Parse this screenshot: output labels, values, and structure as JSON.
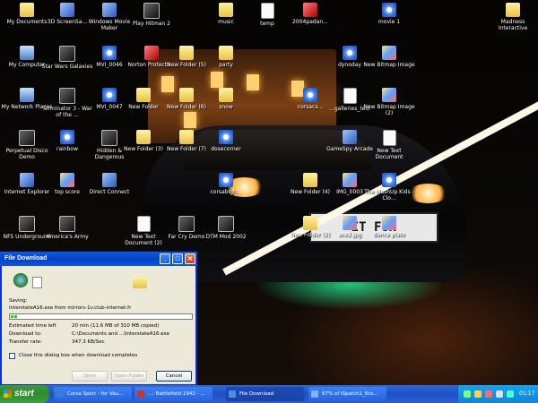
{
  "desktop": {
    "icons": [
      {
        "label": "My Documents",
        "glyph": "folder-docs"
      },
      {
        "label": "3D ScreenSa...",
        "glyph": "screensaver"
      },
      {
        "label": "Windows Movie Maker",
        "glyph": "movie-maker"
      },
      {
        "label": "Play Hitman 2",
        "glyph": "game"
      },
      {
        "label": "music",
        "glyph": "folder"
      },
      {
        "label": "temp",
        "glyph": "document"
      },
      {
        "label": "2004padan...",
        "glyph": "pdf"
      },
      {
        "label": "movie 1",
        "glyph": "media"
      },
      {
        "label": "Madness Interactive",
        "glyph": "folder"
      },
      {
        "label": "My Computer",
        "glyph": "computer"
      },
      {
        "label": "Star Wars Galaxies",
        "glyph": "game"
      },
      {
        "label": "MVI_0046",
        "glyph": "media"
      },
      {
        "label": "Norton Protecte...",
        "glyph": "norton"
      },
      {
        "label": "New Folder (5)",
        "glyph": "folder"
      },
      {
        "label": "party",
        "glyph": "folder"
      },
      {
        "label": "dynoday",
        "glyph": "media"
      },
      {
        "label": "New Bitmap Image",
        "glyph": "paint"
      },
      {
        "label": "My Network Places",
        "glyph": "network"
      },
      {
        "label": "Terminator 3 - War of the ...",
        "glyph": "game"
      },
      {
        "label": "MVI_0047",
        "glyph": "media"
      },
      {
        "label": "New Folder",
        "glyph": "folder"
      },
      {
        "label": "New Folder (6)",
        "glyph": "folder"
      },
      {
        "label": "snow",
        "glyph": "folder"
      },
      {
        "label": "corsacs...",
        "glyph": "media"
      },
      {
        "label": "...galleries_tedi",
        "glyph": "document"
      },
      {
        "label": "New Bitmap Image (2)",
        "glyph": "paint"
      },
      {
        "label": "Perpetual Disco Demo",
        "glyph": "game"
      },
      {
        "label": "rainbow",
        "glyph": "media"
      },
      {
        "label": "Hidden & Dangerous",
        "glyph": "game"
      },
      {
        "label": "New Folder (3)",
        "glyph": "folder"
      },
      {
        "label": "New Folder (7)",
        "glyph": "folder"
      },
      {
        "label": "dosecorner",
        "glyph": "media"
      },
      {
        "label": "GameSpy Arcade",
        "glyph": "app"
      },
      {
        "label": "New Text Document",
        "glyph": "document"
      },
      {
        "label": "Internet Explorer",
        "glyph": "ie"
      },
      {
        "label": "top score",
        "glyph": "paint"
      },
      {
        "label": "Direct Connect",
        "glyph": "app"
      },
      {
        "label": "corsablgh...",
        "glyph": "media"
      },
      {
        "label": "New Folder (4)",
        "glyph": "folder"
      },
      {
        "label": "IMG_0003",
        "glyph": "paint"
      },
      {
        "label": "The MashUp Kids - Clo...",
        "glyph": "media"
      },
      {
        "label": "NFS Underground",
        "glyph": "game"
      },
      {
        "label": "America's Army",
        "glyph": "game"
      },
      {
        "label": "New Text Document (2)",
        "glyph": "document"
      },
      {
        "label": "Far Cry Demo",
        "glyph": "game"
      },
      {
        "label": "DTM Mod 2002",
        "glyph": "game"
      },
      {
        "label": "New Folder (2)",
        "glyph": "folder"
      },
      {
        "label": "ace2.jpg",
        "glyph": "paint"
      },
      {
        "label": "dance plate",
        "glyph": "paint"
      }
    ],
    "plate_text": "IT FUN"
  },
  "dialog": {
    "title": "File Download",
    "saving_label": "Saving:",
    "file_line": "InterstateA16.exe from mirrors-1v.club-internet.fr",
    "progress_fraction": 0.037,
    "rows": [
      {
        "label": "Estimated time left",
        "value": "20 min (11.6 MB of 310 MB copied)"
      },
      {
        "label": "Download to:",
        "value": "C:\\Documents and ...\\InterstateA16.exe"
      },
      {
        "label": "Transfer rate:",
        "value": "347.3 KB/Sec"
      }
    ],
    "close_checkbox_label": "Close this dialog box when download completes",
    "buttons": {
      "open": "Open",
      "open_folder": "Open Folder",
      "cancel": "Cancel"
    },
    "title_buttons": {
      "minimize": "_",
      "maximize": "□",
      "close": "✕"
    }
  },
  "taskbar": {
    "start_label": "start",
    "tasks": [
      {
        "label": "Corsa Sport - for Vau...",
        "active": false
      },
      {
        "label": "...: Battlefield 1942 - ...",
        "active": false
      },
      {
        "label": "File Download",
        "active": true
      },
      {
        "label": "67% of ISpatch1_6to...",
        "active": false
      }
    ],
    "clock": "01:17"
  }
}
